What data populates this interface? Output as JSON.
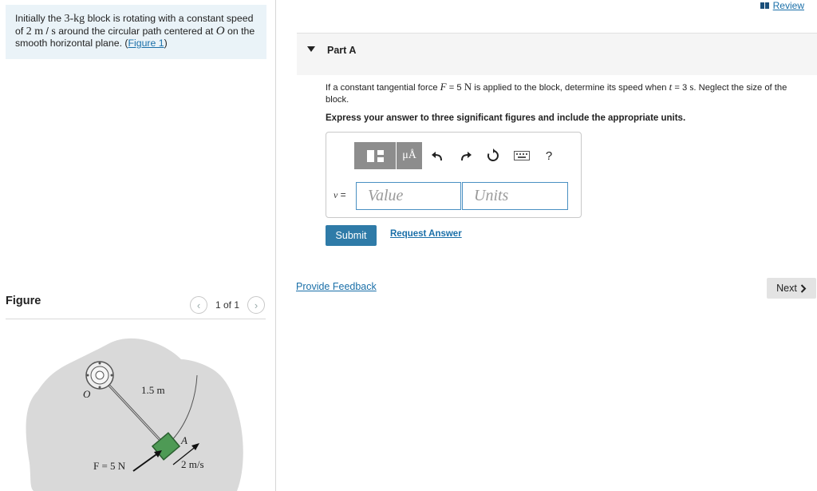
{
  "problem": {
    "text_a": "Initially the ",
    "mass": "3-kg",
    "text_b": " block is rotating with a constant speed of ",
    "speed": "2 m",
    "slash": " / ",
    "speed_unit": "s",
    "text_c": " around the circular path centered at ",
    "center": "O",
    "text_d": " on the smooth horizontal plane. (",
    "figure_link": "Figure 1",
    "text_e": ")"
  },
  "figure_panel": {
    "label": "Figure",
    "counter": "1 of 1",
    "prev_icon": "chevron-left-icon",
    "next_icon": "chevron-right-icon",
    "diagram": {
      "label_o": "O",
      "label_length": "1.5 m",
      "label_a": "A",
      "label_force": "F = 5 N",
      "label_velocity": "2 m/s",
      "block_color": "#4e9a55",
      "plane_color": "#d9d9d9"
    }
  },
  "review": {
    "label": "Review",
    "icon": "book-icon"
  },
  "part": {
    "title": "Part A",
    "q_a": "If a constant tangential force ",
    "q_F": "F",
    "q_eq": " = 5 ",
    "q_N": "N",
    "q_b": " is applied to the block, determine its speed when ",
    "q_t": "t",
    "q_c": " = 3 ",
    "q_s": "s",
    "q_d": ". Neglect the size of the block.",
    "instruction": "Express your answer to three significant figures and include the appropriate units."
  },
  "answer": {
    "variable": "v",
    "equals": " =",
    "value_placeholder": "Value",
    "units_placeholder": "Units",
    "toolbar": {
      "mu_label": "μÅ",
      "help_label": "?",
      "icons": [
        "templates-icon",
        "units-icon",
        "undo-icon",
        "redo-icon",
        "reset-icon",
        "keyboard-icon",
        "help-icon"
      ]
    }
  },
  "buttons": {
    "submit": "Submit",
    "request_answer": "Request Answer",
    "provide_feedback": "Provide Feedback",
    "next": "Next"
  },
  "colors": {
    "accent": "#2f7ba8",
    "link": "#1a6fa8",
    "problem_bg": "#eaf3f8",
    "input_border": "#4a90c2"
  }
}
